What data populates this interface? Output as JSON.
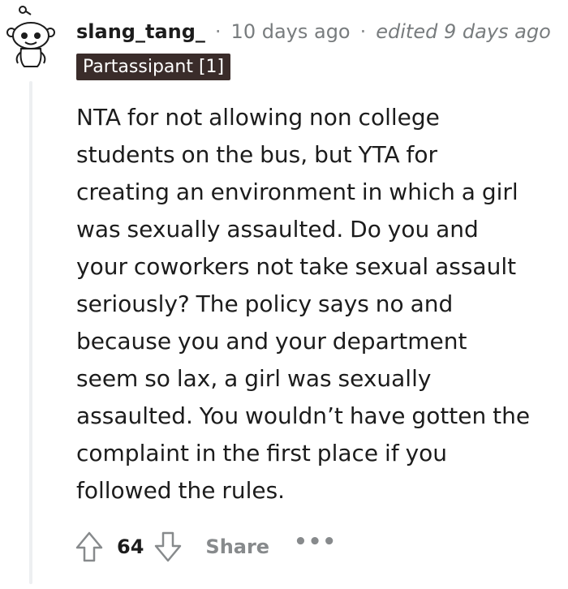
{
  "comment": {
    "author": "slang_tang_",
    "separator": "·",
    "timestamp": "10 days ago",
    "edited": "edited 9 days ago",
    "flair": "Partassipant [1]",
    "body": "NTA for not allowing non college\nstudents on the bus, but YTA for\ncreating an environment in which a girl\nwas sexually assaulted. Do you and\nyour coworkers not take sexual assault\nseriously? The policy says no and\nbecause you and your department\nseem so lax, a girl was sexually\nassaulted. You wouldn’t have gotten the\ncomplaint in the first place if you\nfollowed the rules."
  },
  "actions": {
    "upvote_icon": "upvote-arrow-icon",
    "score": "64",
    "downvote_icon": "downvote-arrow-icon",
    "share_label": "Share",
    "more_label": "•••",
    "more_icon": "more-options-icon"
  },
  "colors": {
    "text": "#1c1c1c",
    "meta_text": "#787c7e",
    "flair_bg": "#3a2c2a",
    "flair_text": "#ffffff",
    "action_gray": "#878a8c",
    "thread_line": "#edeff1"
  }
}
